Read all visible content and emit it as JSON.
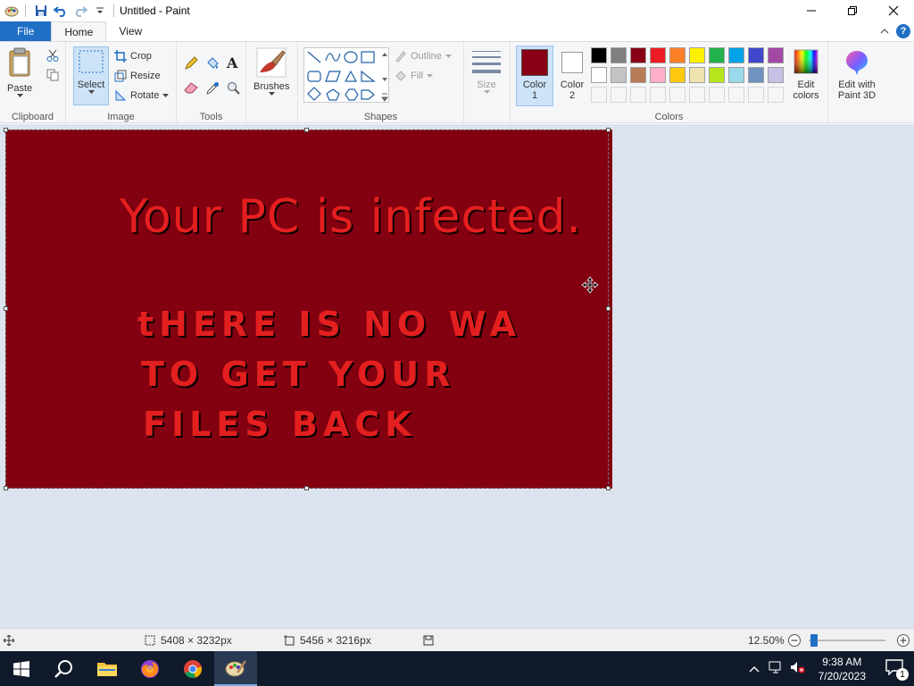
{
  "window": {
    "title": "Untitled - Paint"
  },
  "tabs": {
    "file": "File",
    "home": "Home",
    "view": "View"
  },
  "ribbon": {
    "clipboard": {
      "label": "Clipboard",
      "paste": "Paste"
    },
    "image": {
      "label": "Image",
      "select": "Select",
      "crop": "Crop",
      "resize": "Resize",
      "rotate": "Rotate"
    },
    "tools": {
      "label": "Tools"
    },
    "brushes": {
      "label": "Brushes"
    },
    "shapes": {
      "label": "Shapes",
      "outline": "Outline",
      "fill": "Fill"
    },
    "size": {
      "label": "Size"
    },
    "colors": {
      "label": "Colors",
      "color1": "Color\n1",
      "color1_a": "Color",
      "color1_b": "1",
      "color2_a": "Color",
      "color2_b": "2",
      "edit_a": "Edit",
      "edit_b": "colors",
      "paint3d_a": "Edit with",
      "paint3d_b": "Paint 3D",
      "color1_value": "#880015",
      "color2_value": "#ffffff",
      "palette_row1": [
        "#000000",
        "#7f7f7f",
        "#880015",
        "#ed1c24",
        "#ff7f27",
        "#fff200",
        "#22b14c",
        "#00a2e8",
        "#3f48cc",
        "#a349a4"
      ],
      "palette_row2": [
        "#ffffff",
        "#c3c3c3",
        "#b97a57",
        "#ffaec9",
        "#ffc90e",
        "#efe4b0",
        "#b5e61d",
        "#99d9ea",
        "#7092be",
        "#c8bfe7"
      ],
      "palette_row3": [
        "#f5f6f7",
        "#f5f6f7",
        "#f5f6f7",
        "#f5f6f7",
        "#f5f6f7",
        "#f5f6f7",
        "#f5f6f7",
        "#f5f6f7",
        "#f5f6f7",
        "#f5f6f7"
      ]
    }
  },
  "canvas": {
    "background": "#820010",
    "line1": "Your PC is infected.",
    "line2": "tHERE IS NO WA",
    "line3": "TO GET YOUR",
    "line4": "FILES BACK"
  },
  "status": {
    "image_size": "5408 × 3232px",
    "selection_size": "5456 × 3216px",
    "zoom": "12.50%"
  },
  "taskbar": {
    "time": "9:38 AM",
    "date": "7/20/2023",
    "notifications": "1"
  }
}
